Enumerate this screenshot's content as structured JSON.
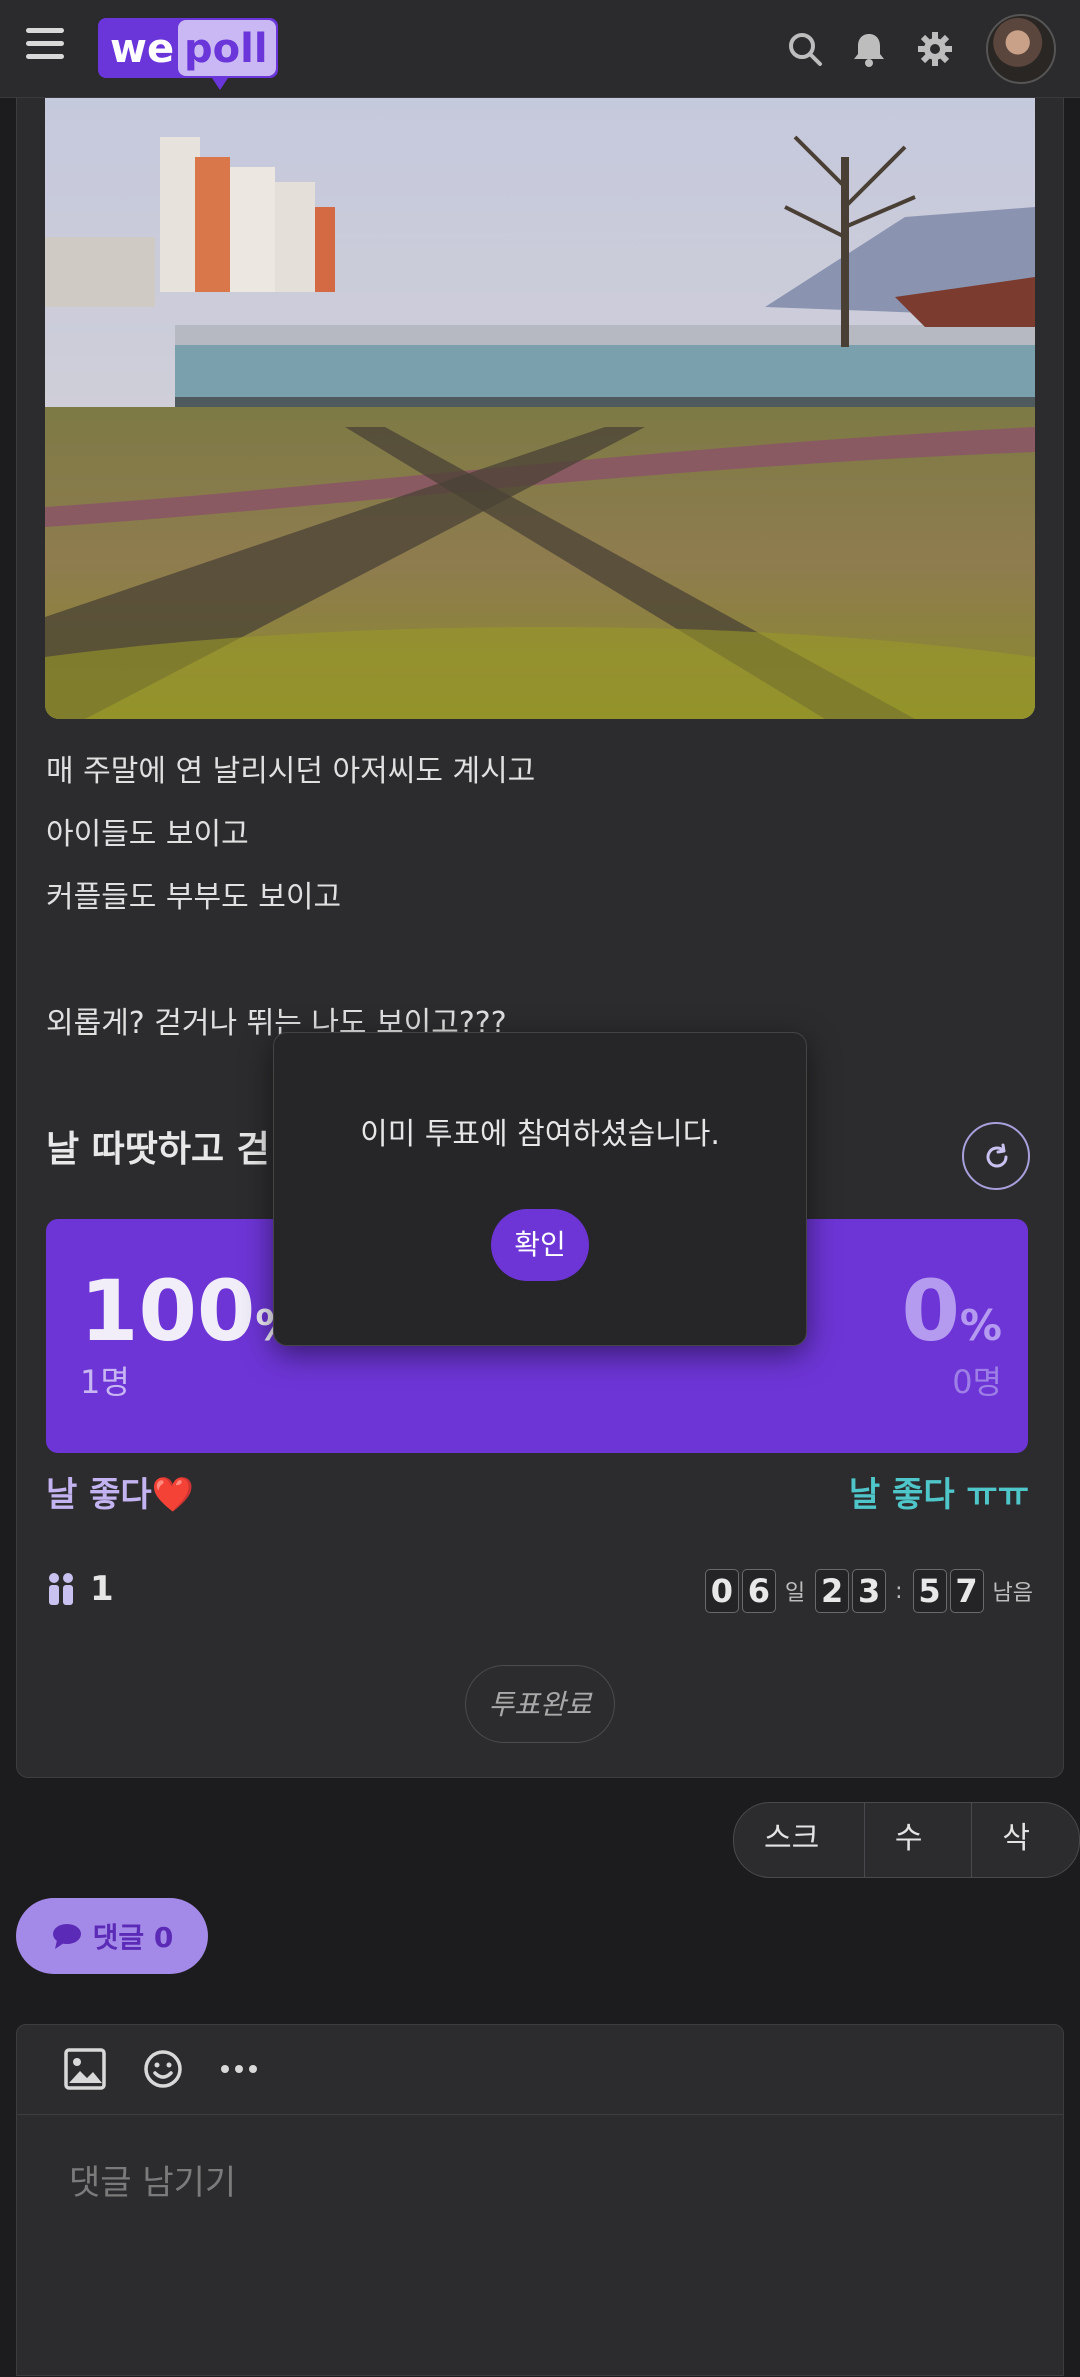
{
  "header": {
    "logo_we": "we",
    "logo_poll": "poll"
  },
  "post": {
    "lines": [
      "매 주말에 연 날리시던 아저씨도 계시고",
      "아이들도 보이고",
      "커플들도 부부도 보이고",
      "",
      "외롭게? 걷거나 뛰는 나도 보이고???"
    ]
  },
  "poll": {
    "question": "날 따땃하고 걷",
    "left": {
      "percent": "100",
      "percent_sign": "%",
      "count": "1명",
      "fraction": 1.0,
      "label": "날 좋다❤️"
    },
    "right": {
      "percent": "0",
      "percent_sign": "%",
      "count": "0명",
      "fraction": 0.0,
      "label": "날 좋다 ㅠㅠ"
    },
    "voters": "1",
    "timer": {
      "d1": "0",
      "d2": "6",
      "day_unit": "일",
      "h1": "2",
      "h2": "3",
      "sep": ":",
      "m1": "5",
      "m2": "7",
      "remain": "남음"
    },
    "done_label": "투표완료"
  },
  "actions": {
    "scrap": "스크랩",
    "edit": "수정",
    "delete": "삭제"
  },
  "comments": {
    "button_label": "댓글 0",
    "placeholder": "댓글 남기기"
  },
  "modal": {
    "message": "이미 투표에 참여하셨습니다.",
    "ok": "확인"
  },
  "colors": {
    "accent": "#6d35d6",
    "teal": "#4fc6c9"
  }
}
